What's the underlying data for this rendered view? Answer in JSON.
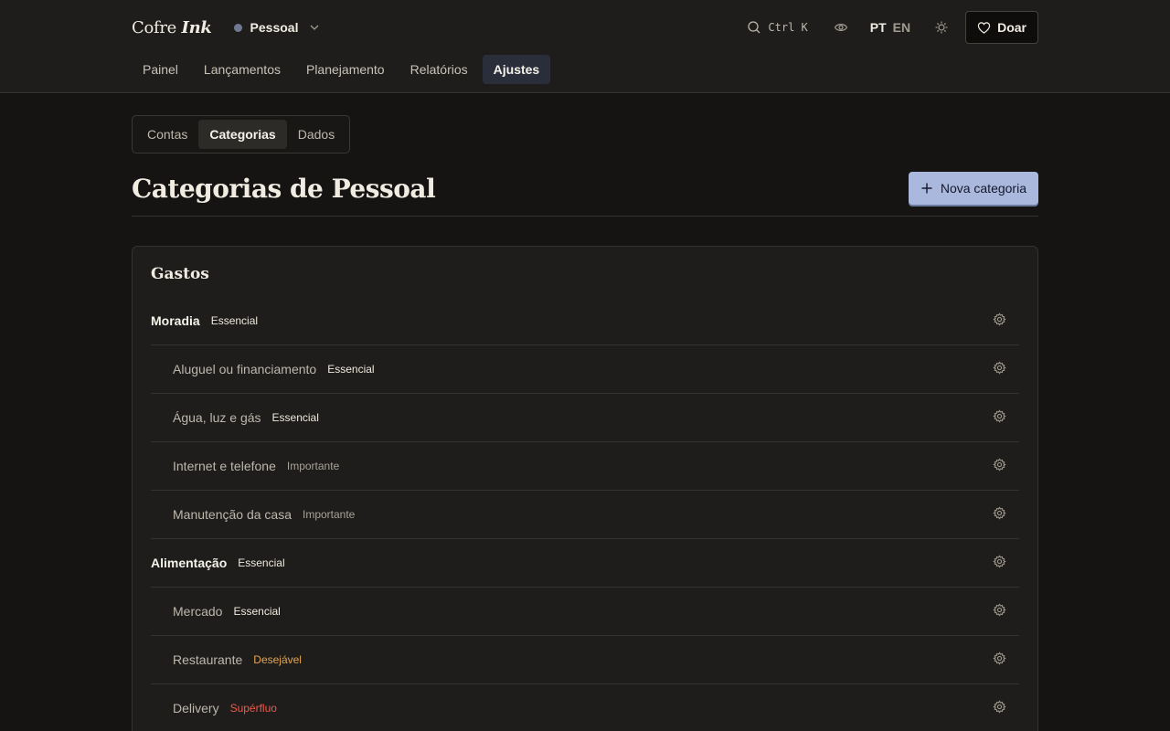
{
  "brand": {
    "name": "Cofre",
    "accent": "Ink"
  },
  "space": {
    "name": "Pessoal"
  },
  "search": {
    "shortcut": "Ctrl K"
  },
  "lang": {
    "pt": "PT",
    "en": "EN"
  },
  "donate": {
    "label": "Doar"
  },
  "nav": [
    "Painel",
    "Lançamentos",
    "Planejamento",
    "Relatórios",
    "Ajustes"
  ],
  "tabs": [
    "Contas",
    "Categorias",
    "Dados"
  ],
  "page": {
    "title": "Categorias de Pessoal",
    "new_button": "Nova categoria"
  },
  "section": {
    "title": "Gastos"
  },
  "categories": [
    {
      "name": "Moradia",
      "badge": "Essencial"
    },
    {
      "name": "Aluguel ou financiamento",
      "badge": "Essencial"
    },
    {
      "name": "Água, luz e gás",
      "badge": "Essencial"
    },
    {
      "name": "Internet e telefone",
      "badge": "Importante"
    },
    {
      "name": "Manutenção da casa",
      "badge": "Importante"
    },
    {
      "name": "Alimentação",
      "badge": "Essencial"
    },
    {
      "name": "Mercado",
      "badge": "Essencial"
    },
    {
      "name": "Restaurante",
      "badge": "Desejável"
    },
    {
      "name": "Delivery",
      "badge": "Supérfluo"
    }
  ],
  "colors": {
    "background": "#151412",
    "header": "#1e1d1b",
    "primary_button": "#a9b8dc",
    "essencial": "#efe9dd",
    "importante": "#a8a296",
    "desejavel": "#e3a54f",
    "superfluo": "#ec5a4c"
  },
  "icons": [
    "search-icon",
    "eye-icon",
    "sun-icon",
    "heart-icon",
    "plus-icon",
    "gear-icon",
    "chevron-down-icon"
  ]
}
